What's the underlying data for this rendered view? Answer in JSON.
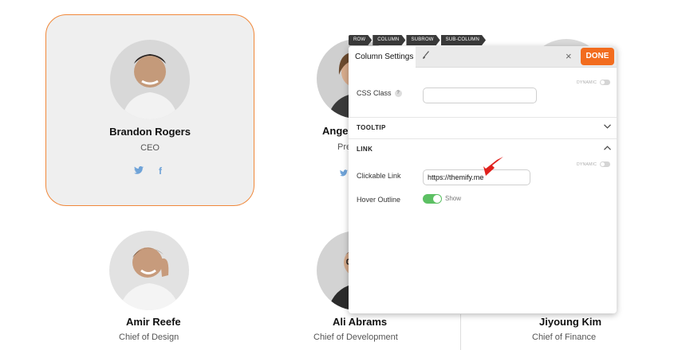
{
  "cards": [
    {
      "name": "Brandon Rogers",
      "role": "CEO"
    },
    {
      "name": "Angeli",
      "role": "Pre"
    },
    {
      "name": "Amir Reefe",
      "role": "Chief of Design"
    },
    {
      "name": "Ali Abrams",
      "role": "Chief of Development"
    },
    {
      "name": "Jiyoung Kim",
      "role": "Chief of Finance"
    }
  ],
  "social": {
    "twitter": "twitter-icon",
    "facebook": "facebook-icon",
    "facebook_glyph": "f"
  },
  "breadcrumb": [
    "ROW",
    "COLUMN",
    "SUBROW",
    "SUB-COLUMN"
  ],
  "panel": {
    "tab_label": "Column Settings",
    "tab_icon": "brush-icon",
    "close_label": "×",
    "done_label": "DONE",
    "dynamic_label": "DYNAMIC",
    "css_class_label": "CSS Class",
    "help_glyph": "?",
    "css_class_value": "",
    "tooltip_section": "TOOLTIP",
    "link_section": "LINK",
    "clickable_link_label": "Clickable Link",
    "clickable_link_value": "https://themify.me",
    "hover_outline_label": "Hover Outline",
    "hover_outline_toggle_label": "Show",
    "hover_outline_on": true
  },
  "colors": {
    "accent": "#f26c1e",
    "card_border": "#f0883a",
    "toggle_on": "#5cc063",
    "social": "#6fa3d8",
    "arrow": "#e0201c"
  }
}
